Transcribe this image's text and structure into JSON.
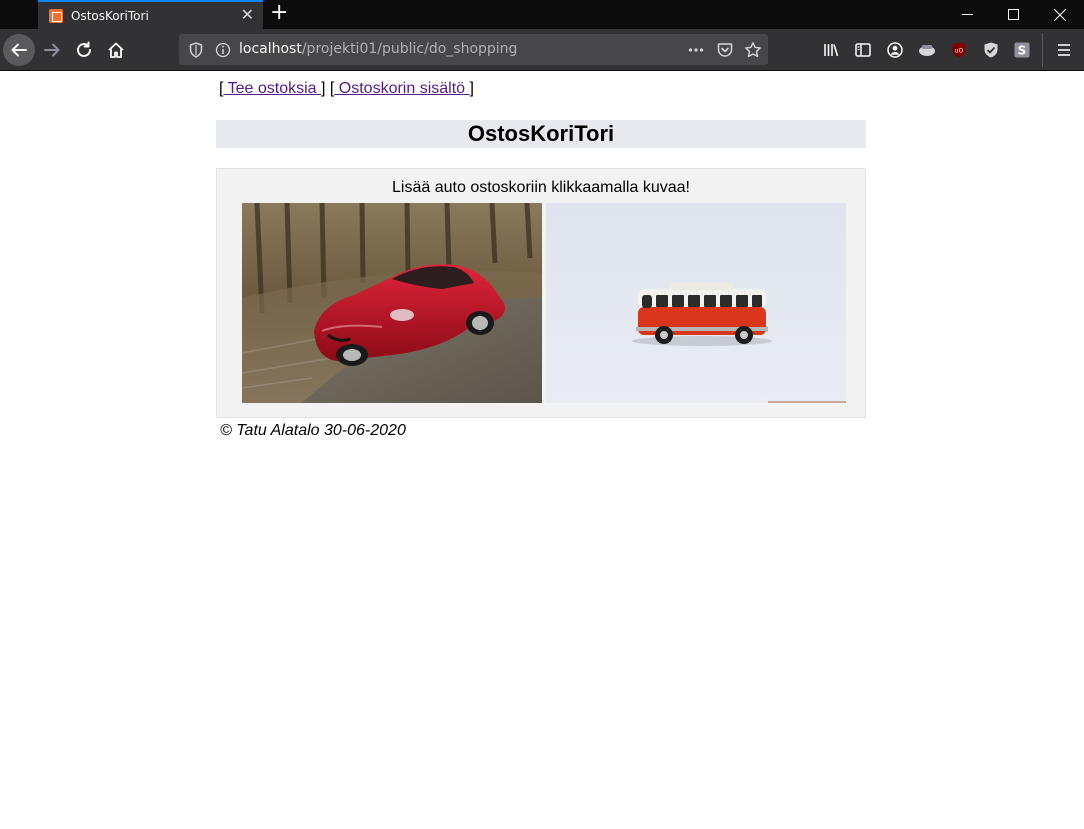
{
  "browser": {
    "tab_title": "OstosKoriTori",
    "url_host": "localhost",
    "url_path": "/projekti01/public/do_shopping",
    "colors": {
      "accent": "#0a84ff",
      "tab_bg": "#323234",
      "chrome_bg": "#0c0c0d"
    }
  },
  "page": {
    "nav": {
      "open_bracket_1": "[",
      "link_shop": " Tee ostoksia ",
      "mid_bracket": "] [",
      "link_cart": " Ostoskorin sisältö ",
      "close_bracket_2": "]"
    },
    "title": "OstosKoriTori",
    "instructions": "Lisää auto ostoskoriin klikkaamalla kuvaa!",
    "products": [
      {
        "name": "red-sports-car",
        "color": "#c1121f"
      },
      {
        "name": "red-van-toy",
        "color": "#d9361c"
      }
    ],
    "footer": "© Tatu Alatalo 30-06-2020"
  }
}
